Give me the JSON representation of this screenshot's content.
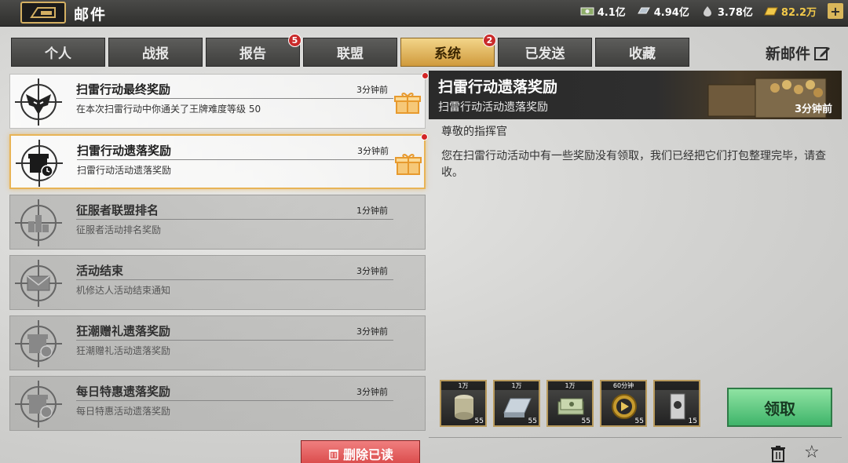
{
  "header": {
    "title": "邮件",
    "currencies": [
      {
        "icon": "cash-icon",
        "value": "4.1亿"
      },
      {
        "icon": "steel-icon",
        "value": "4.94亿"
      },
      {
        "icon": "oil-icon",
        "value": "3.78亿"
      },
      {
        "icon": "gold-icon",
        "value": "82.2万"
      }
    ],
    "plus_label": "+"
  },
  "tabs": [
    {
      "label": "个人",
      "badge": ""
    },
    {
      "label": "战报",
      "badge": ""
    },
    {
      "label": "报告",
      "badge": "5"
    },
    {
      "label": "联盟",
      "badge": ""
    },
    {
      "label": "系统",
      "badge": "2",
      "active": true
    },
    {
      "label": "已发送",
      "badge": ""
    },
    {
      "label": "收藏",
      "badge": ""
    }
  ],
  "new_mail_label": "新邮件",
  "mails": [
    {
      "title": "扫雷行动最终奖励",
      "subtitle": "在本次扫雷行动中你通关了王牌难度等级 50",
      "time": "3分钟前",
      "icon": "eagle-emblem-icon",
      "has_gift": true,
      "unread": true
    },
    {
      "title": "扫雷行动遗落奖励",
      "subtitle": "扫雷行动活动遗落奖励",
      "time": "3分钟前",
      "icon": "gift-clock-icon",
      "has_gift": true,
      "unread": true,
      "selected": true
    },
    {
      "title": "征服者联盟排名",
      "subtitle": "征服者活动排名奖励",
      "time": "1分钟前",
      "icon": "ranking-bars-icon",
      "has_gift": false,
      "unread": false
    },
    {
      "title": "活动结束",
      "subtitle": "机修达人活动结束通知",
      "time": "3分钟前",
      "icon": "envelope-icon",
      "has_gift": false,
      "unread": false
    },
    {
      "title": "狂潮赠礼遗落奖励",
      "subtitle": "狂潮赠礼活动遗落奖励",
      "time": "3分钟前",
      "icon": "gift-clock-icon",
      "has_gift": false,
      "unread": false
    },
    {
      "title": "每日特惠遗落奖励",
      "subtitle": "每日特惠活动遗落奖励",
      "time": "3分钟前",
      "icon": "gift-clock-icon",
      "has_gift": false,
      "unread": false
    }
  ],
  "delete_read_label": "删除已读",
  "detail": {
    "title": "扫雷行动遗落奖励",
    "subtitle": "扫雷行动活动遗落奖励",
    "time": "3分钟前",
    "greeting": "尊敬的指挥官",
    "body": "您在扫雷行动活动中有一些奖励没有领取，我们已经把它们打包整理完毕，请查收。",
    "rewards": [
      {
        "label": "1万",
        "count": "55",
        "icon": "oil-barrel-icon"
      },
      {
        "label": "1万",
        "count": "55",
        "icon": "steel-ingot-icon"
      },
      {
        "label": "1万",
        "count": "55",
        "icon": "cash-stack-icon"
      },
      {
        "label": "60分钟",
        "count": "55",
        "icon": "speedup-icon"
      },
      {
        "label": "",
        "count": "15",
        "icon": "ticket-icon"
      }
    ],
    "claim_label": "领取"
  }
}
